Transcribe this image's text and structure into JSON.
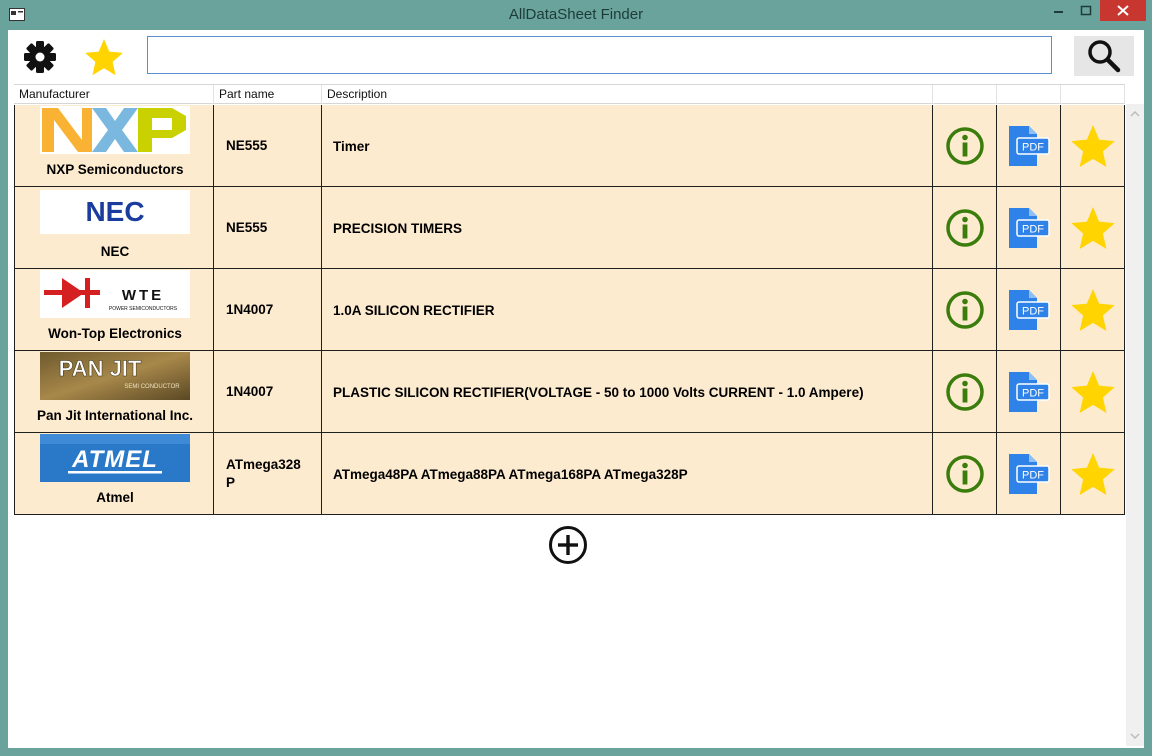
{
  "window": {
    "title": "AllDataSheet Finder"
  },
  "toolbar": {
    "settings_icon": "gear-icon",
    "favorites_icon": "star-icon",
    "search": {
      "value": "",
      "placeholder": ""
    },
    "search_icon": "magnifier-icon"
  },
  "columns": [
    "Manufacturer",
    "Part name",
    "Description",
    "",
    "",
    ""
  ],
  "rows": [
    {
      "manufacturer": "NXP Semiconductors",
      "logo": "nxp-logo",
      "part": "NE555",
      "description": "Timer"
    },
    {
      "manufacturer": "NEC",
      "logo": "nec-logo",
      "part": "NE555",
      "description": "PRECISION TIMERS"
    },
    {
      "manufacturer": "Won-Top Electronics",
      "logo": "wte-logo",
      "part": "1N4007",
      "description": "1.0A SILICON RECTIFIER"
    },
    {
      "manufacturer": "Pan Jit International Inc.",
      "logo": "panjit-logo",
      "part": "1N4007",
      "description": "PLASTIC SILICON RECTIFIER(VOLTAGE - 50 to 1000 Volts CURRENT - 1.0 Ampere)"
    },
    {
      "manufacturer": "Atmel",
      "logo": "atmel-logo",
      "part": "ATmega328P",
      "description": "ATmega48PA ATmega88PA ATmega168PA ATmega328P"
    }
  ],
  "logos": {
    "nec": "NEC",
    "wte": "WTE",
    "wte_sub": "POWER SEMICONDUCTORS",
    "panjit": "PAN JIT",
    "panjit_sub": "SEMI CONDUCTOR",
    "atmel": "ATMEL"
  },
  "row_icons": {
    "info": "info-icon",
    "pdf": "pdf-icon",
    "pdf_text": "PDF",
    "favorite": "star-icon"
  },
  "add_icon": "plus-circle-icon",
  "colors": {
    "row_bg": "#fdebd0",
    "info_green": "#3a7d0c",
    "pdf_blue": "#2f83e8",
    "star_yellow": "#ffd400",
    "close_red": "#c7372f",
    "frame": "#6aa39c"
  }
}
